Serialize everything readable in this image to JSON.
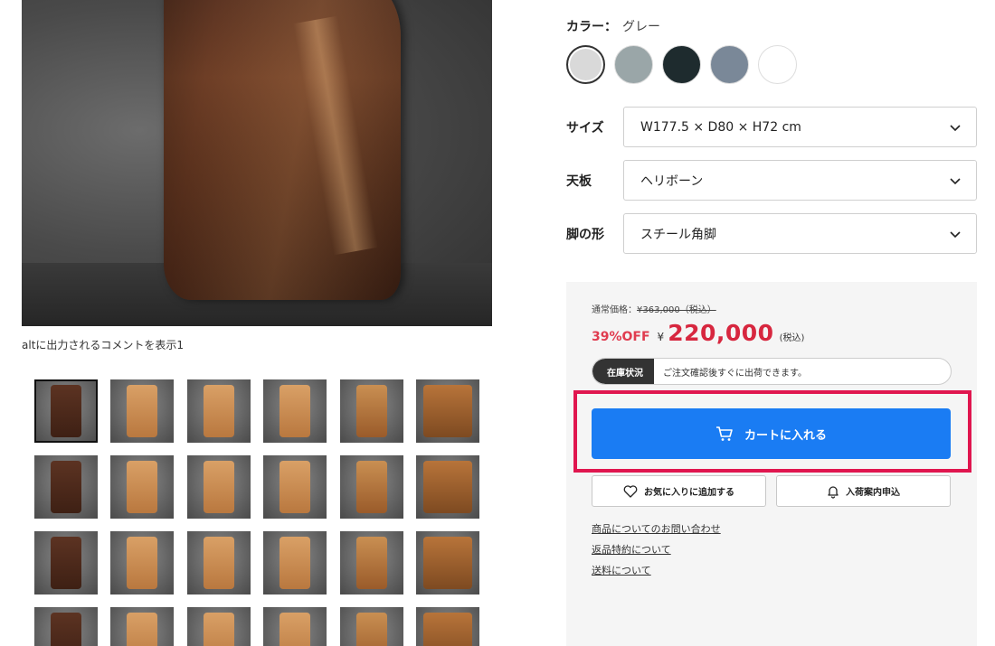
{
  "gallery": {
    "caption": "altに出力されるコメントを表示1",
    "thumbnails": [
      {
        "tone": "dark",
        "selected": true
      },
      {
        "tone": "light"
      },
      {
        "tone": "light"
      },
      {
        "tone": "light"
      },
      {
        "tone": "mid"
      },
      {
        "tone": "wide"
      },
      {
        "tone": "dark"
      },
      {
        "tone": "light"
      },
      {
        "tone": "light"
      },
      {
        "tone": "light"
      },
      {
        "tone": "mid"
      },
      {
        "tone": "wide"
      },
      {
        "tone": "dark"
      },
      {
        "tone": "light"
      },
      {
        "tone": "light"
      },
      {
        "tone": "light"
      },
      {
        "tone": "mid"
      },
      {
        "tone": "wide"
      },
      {
        "tone": "dark"
      },
      {
        "tone": "light"
      },
      {
        "tone": "light"
      },
      {
        "tone": "light"
      },
      {
        "tone": "mid"
      },
      {
        "tone": "wide"
      }
    ]
  },
  "color": {
    "label": "カラー：",
    "value": "グレー",
    "swatches": [
      "#d9d9d9",
      "#9aa6a8",
      "#1e2b2e",
      "#7a8898",
      "#ffffff"
    ],
    "selected_index": 0
  },
  "options": {
    "size": {
      "label": "サイズ",
      "value": "W177.5 × D80 × H72 cm"
    },
    "top": {
      "label": "天板",
      "value": "ヘリボーン"
    },
    "legs": {
      "label": "脚の形",
      "value": "スチール角脚"
    }
  },
  "purchase": {
    "regular_label": "通常価格：",
    "regular_price": "¥363,000（税込）",
    "discount": "39%OFF",
    "currency": "¥",
    "price": "220,000",
    "tax_note": "(税込)",
    "stock_tag": "在庫状況",
    "stock_message": "ご注文確認後すぐに出荷できます。",
    "cart_button": "カートに入れる",
    "favorite_button": "お気に入りに追加する",
    "restock_button": "入荷案内申込",
    "colors": {
      "accent": "#1a7cf3",
      "price": "#d7273f",
      "highlight": "#e0164f"
    }
  },
  "links": [
    "商品についてのお問い合わせ",
    "返品特約について",
    "送料について"
  ]
}
